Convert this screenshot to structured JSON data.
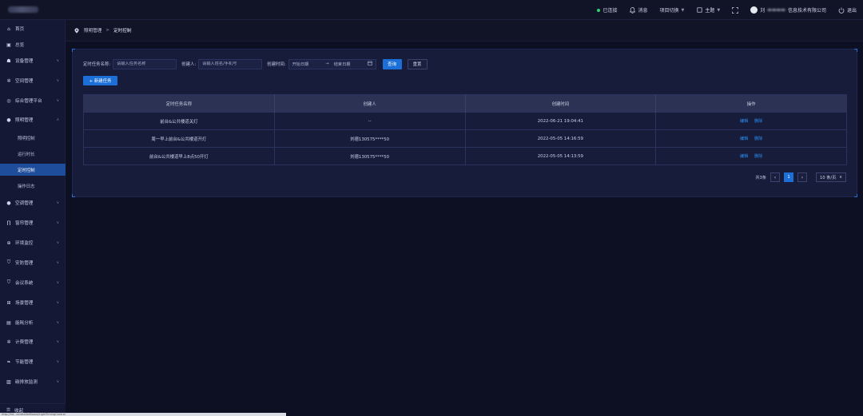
{
  "header": {
    "connection_status": "已连接",
    "messages_label": "消息",
    "project_switch_label": "项目切换",
    "theme_label": "主题",
    "user_name": "刘",
    "company_name": "信息技术有限公司",
    "logout_label": "退出"
  },
  "sidebar": {
    "items": [
      {
        "label": "首页",
        "icon": "home-icon"
      },
      {
        "label": "总览",
        "icon": "monitor-icon"
      },
      {
        "label": "设备管理",
        "icon": "user-icon"
      },
      {
        "label": "空间管理",
        "icon": "gear-icon"
      },
      {
        "label": "综合管理平台",
        "icon": "cube-icon"
      },
      {
        "label": "照明管理",
        "icon": "location-icon"
      },
      {
        "label": "空调管理",
        "icon": "location-icon"
      },
      {
        "label": "窗帘管理",
        "icon": "curtain-icon"
      },
      {
        "label": "环境监控",
        "icon": "globe-icon"
      },
      {
        "label": "安防管理",
        "icon": "shield-icon"
      },
      {
        "label": "会议系统",
        "icon": "shield-icon"
      },
      {
        "label": "场景管理",
        "icon": "grid-icon"
      },
      {
        "label": "能耗分析",
        "icon": "calendar-icon"
      },
      {
        "label": "计费管理",
        "icon": "gear-icon"
      },
      {
        "label": "节能管理",
        "icon": "leaf-icon"
      },
      {
        "label": "碳排放监测",
        "icon": "image-icon"
      }
    ],
    "sub_items": [
      {
        "label": "照明控制",
        "active": false
      },
      {
        "label": "运行时长",
        "active": false
      },
      {
        "label": "定时控制",
        "active": true
      },
      {
        "label": "操作日志",
        "active": false
      }
    ],
    "collapse_label": "收起"
  },
  "status_url": "http://hd...controllerBoard/LightTimingControl",
  "breadcrumb": {
    "parent": "照明管理",
    "separator": ">",
    "current": "定时控制"
  },
  "filters": {
    "task_name_label": "定时任务名称:",
    "task_name_placeholder": "请输入任务名称",
    "creator_label": "创建人:",
    "creator_placeholder": "请输入姓名/手机号",
    "created_time_label": "创建时间:",
    "start_date_placeholder": "开始日期",
    "range_arrow": "→",
    "end_date_placeholder": "结束日期",
    "search_label": "查询",
    "reset_label": "重置"
  },
  "add_task_label": "+ 新建任务",
  "table": {
    "columns": [
      "定时任务名称",
      "创建人",
      "创建时间",
      "操作"
    ],
    "rows": [
      {
        "name": "前台&公共楼道关灯",
        "creator": "--",
        "created_at": "2022-06-21 19:04:41"
      },
      {
        "name": "周一早上前台&公共楼道开灯",
        "creator": "刘德130575****50",
        "created_at": "2022-05-05 14:16:59"
      },
      {
        "name": "前台&公共楼道早上8点50开灯",
        "creator": "刘德130575****50",
        "created_at": "2022-05-05 14:13:59"
      }
    ],
    "edit_label": "编辑",
    "delete_label": "删除"
  },
  "pagination": {
    "total_label": "共3条",
    "current_page": "1",
    "page_size_label": "10 条/页"
  },
  "colors": {
    "accent": "#1b6fd7",
    "link": "#2d8cf0",
    "online": "#2fd26b"
  }
}
